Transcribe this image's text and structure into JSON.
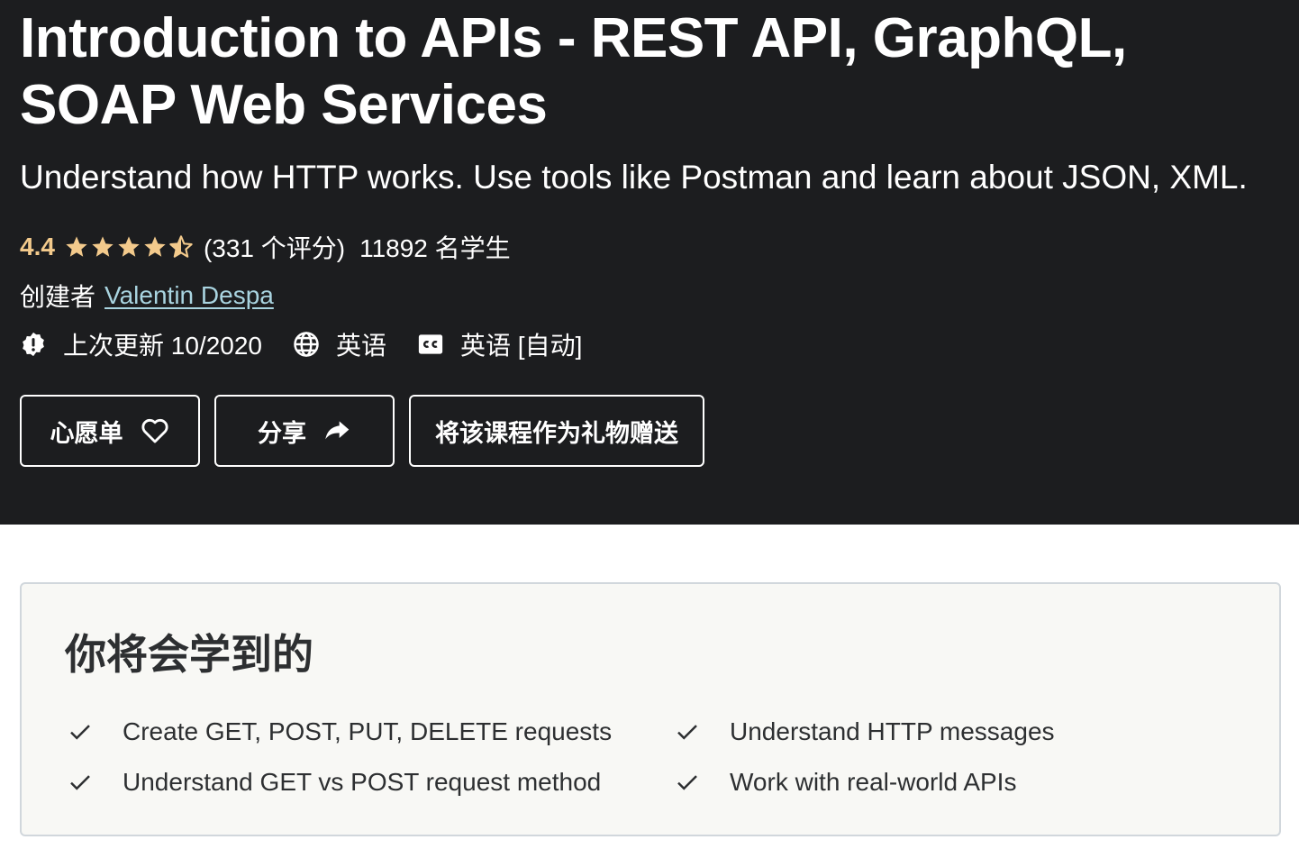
{
  "course": {
    "title": "Introduction to APIs - REST API, GraphQL, SOAP Web Services",
    "subtitle": "Understand how HTTP works. Use tools like Postman and learn about JSON, XML.",
    "rating": {
      "score": "4.4",
      "stars_value": 4.4,
      "stars_max": 5,
      "count_label": "(331 个评分)",
      "students_label": "11892 名学生"
    },
    "creator": {
      "prefix": "创建者",
      "name": "Valentin Despa"
    },
    "meta": {
      "last_updated": "上次更新 10/2020",
      "language": "英语",
      "captions": "英语 [自动]"
    },
    "buttons": {
      "wishlist": "心愿单",
      "share": "分享",
      "gift": "将该课程作为礼物赠送"
    }
  },
  "what_you_learn": {
    "title": "你将会学到的",
    "items": [
      "Create GET, POST, PUT, DELETE requests",
      "Understand HTTP messages",
      "Understand GET vs POST request method",
      "Work with real-world APIs"
    ]
  },
  "colors": {
    "hero_background": "#1c1d1f",
    "rating_accent": "#f3ca8c",
    "creator_link": "#a9d4e0",
    "learn_box_background": "#f8f8f5",
    "learn_box_border": "#d1d7dc"
  },
  "icons": {
    "star": "star-icon",
    "last_updated": "alert-badge-icon",
    "language": "globe-icon",
    "captions": "closed-captions-icon",
    "wishlist": "heart-icon",
    "share": "share-arrow-icon",
    "learn_item": "check-icon"
  }
}
